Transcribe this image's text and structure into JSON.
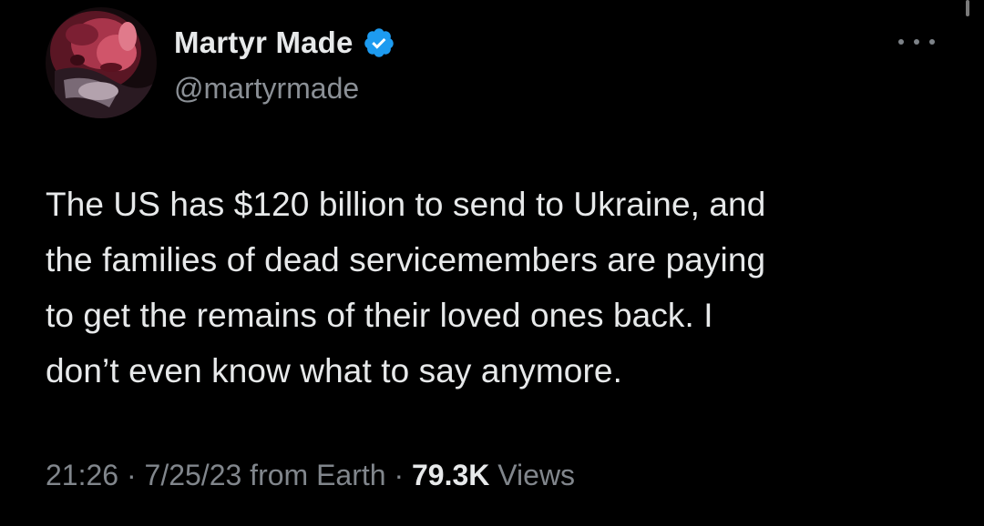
{
  "author": {
    "display_name": "Martyr Made",
    "handle": "@martyrmade",
    "verified": true,
    "verified_icon": "verified-badge-icon",
    "verified_color": "#1d9bf0"
  },
  "tweet": {
    "lines": [
      "The US has $120 billion to send to Ukraine, and",
      "the families of dead servicemembers are paying",
      "to get the remains of their loved ones back. I",
      "don’t even know what to say anymore."
    ]
  },
  "meta": {
    "time": "21:26",
    "separator": " · ",
    "date": "7/25/23",
    "source": "from Earth",
    "views_count": "79.3K",
    "views_label": "Views"
  },
  "icons": {
    "more": "more-options-icon"
  },
  "colors": {
    "background": "#000000",
    "primary_text": "#e7e9ea",
    "secondary_text": "#8b9096",
    "accent": "#1d9bf0"
  }
}
